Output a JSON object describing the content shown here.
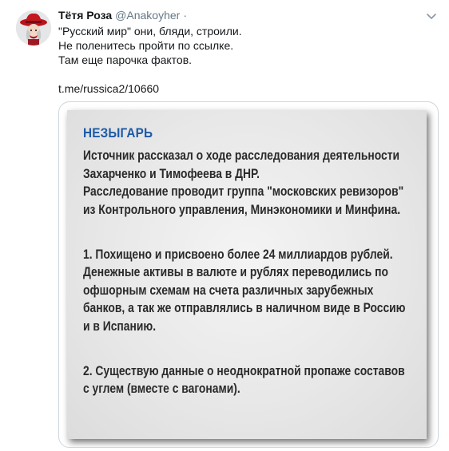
{
  "tweet": {
    "display_name": "Тётя Роза",
    "handle": "@Anakoyher",
    "separator": "·",
    "text_lines": [
      "\"Русский мир\" они, бляди, строили.",
      "Не поленитесь пройти по ссылке.",
      "Там еще парочка фактов."
    ],
    "link": "t.me/russica2/10660",
    "icons": {
      "avatar": "avatar-red-hat",
      "more": "chevron-down-icon"
    }
  },
  "image_card": {
    "heading": "НЕЗЫГАРЬ",
    "paragraph_1": [
      "Источник рассказал о ходе расследования деятельности",
      "Захарченко и Тимофеева в ДНР.",
      "Расследование проводит группа \"московских ревизоров\"",
      "из Контрольного управления, Минэкономики и Минфина."
    ],
    "paragraph_2": [
      "1. Похищено и присвоено более 24 миллиардов рублей.",
      "Денежные активы в валюте и рублях переводились по",
      "офшорным схемам на счета различных зарубежных",
      "банков, а так же отправлялись в наличном виде в Россию",
      "и в Испанию."
    ],
    "paragraph_3": [
      "2. Существую данные о неоднократной пропаже составов",
      "с углем (вместе с вагонами)."
    ],
    "colors": {
      "heading": "#1d5aa6",
      "body": "#2a2a2a"
    }
  }
}
